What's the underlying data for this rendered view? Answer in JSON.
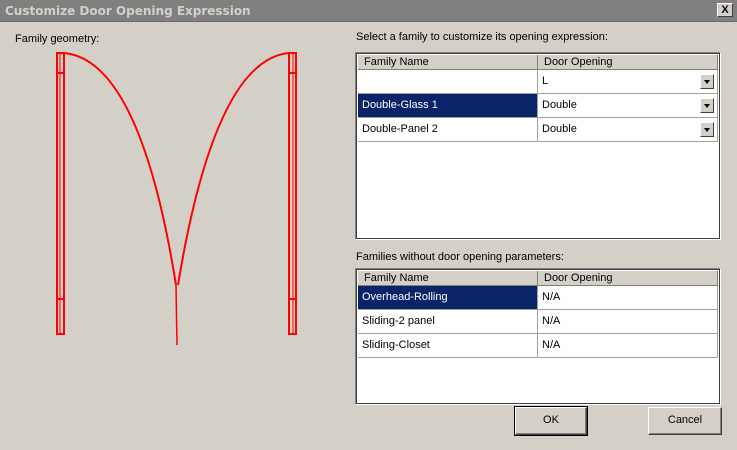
{
  "window": {
    "title": "Customize Door Opening Expression",
    "close_label": "X"
  },
  "geometry": {
    "label": "Family geometry:",
    "color": "#ff0000"
  },
  "families": {
    "label": "Select a family to customize its opening expression:",
    "headers": [
      "Family Name",
      "Door Opening"
    ],
    "rows": [
      {
        "name": "",
        "opening": "L",
        "selected": false
      },
      {
        "name": "Double-Glass 1",
        "opening": "Double",
        "selected": true
      },
      {
        "name": "Double-Panel 2",
        "opening": "Double",
        "selected": false
      }
    ]
  },
  "no_params": {
    "label": "Families without door opening parameters:",
    "headers": [
      "Family Name",
      "Door Opening"
    ],
    "rows": [
      {
        "name": "Overhead-Rolling",
        "opening": "N/A",
        "selected": true
      },
      {
        "name": "Sliding-2 panel",
        "opening": "N/A",
        "selected": false
      },
      {
        "name": "Sliding-Closet",
        "opening": "N/A",
        "selected": false
      }
    ]
  },
  "buttons": {
    "ok": "OK",
    "cancel": "Cancel"
  },
  "colors": {
    "selection": "#0a246a",
    "dialog_bg": "#d4d0c8"
  }
}
